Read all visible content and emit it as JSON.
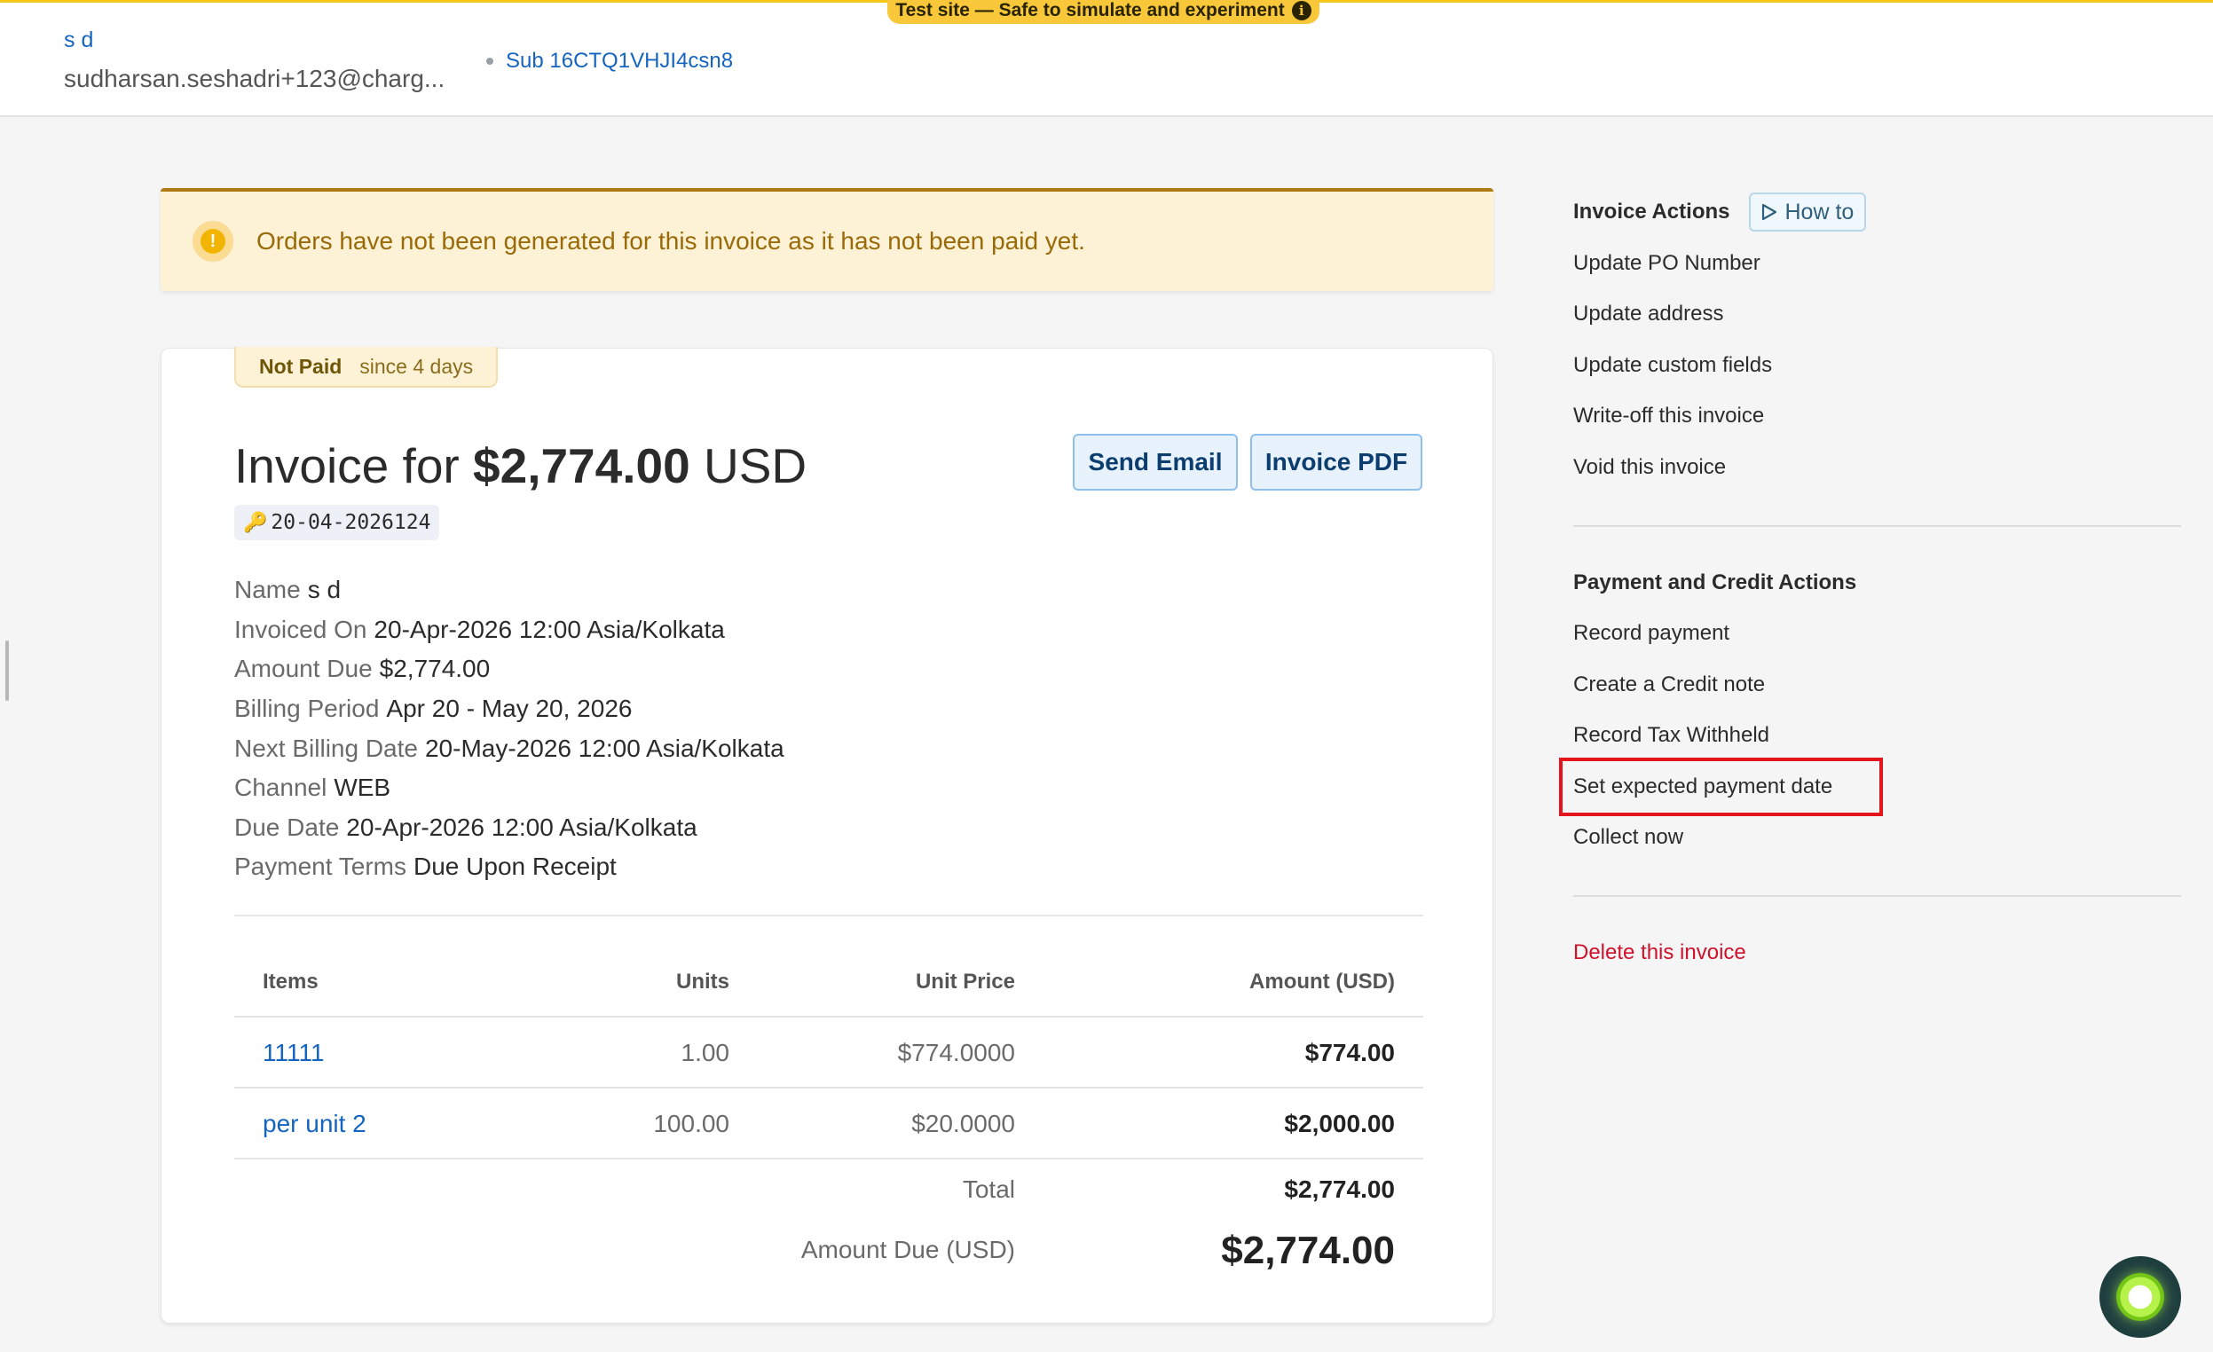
{
  "header": {
    "test_banner": "Test site — Safe to simulate and experiment",
    "info_glyph": "i",
    "customer_name": "s d",
    "customer_email": "sudharsan.seshadri+123@charg...",
    "subscription": "Sub 16CTQ1VHJI4csn8"
  },
  "banner": {
    "icon_glyph": "!",
    "message": "Orders have not been generated for this invoice as it has not been paid yet."
  },
  "invoice": {
    "status": "Not Paid",
    "status_since": "since 4 days",
    "title_prefix": "Invoice for",
    "amount": "$2,774.00",
    "currency": "USD",
    "send_email_label": "Send Email",
    "pdf_label": "Invoice PDF",
    "number": "20-04-2026124",
    "key_icon": "🔑",
    "details": [
      {
        "label": "Name",
        "value": "s d"
      },
      {
        "label": "Invoiced On",
        "value": "20-Apr-2026 12:00 Asia/Kolkata"
      },
      {
        "label": "Amount Due",
        "value": "$2,774.00"
      },
      {
        "label": "Billing Period",
        "value": "Apr 20 - May 20, 2026"
      },
      {
        "label": "Next Billing Date",
        "value": "20-May-2026 12:00 Asia/Kolkata"
      },
      {
        "label": "Channel",
        "value": "WEB"
      },
      {
        "label": "Due Date",
        "value": "20-Apr-2026 12:00 Asia/Kolkata"
      },
      {
        "label": "Payment Terms",
        "value": "Due Upon Receipt"
      }
    ],
    "columns": {
      "items": "Items",
      "units": "Units",
      "unit_price": "Unit Price",
      "amount": "Amount (USD)"
    },
    "line_items": [
      {
        "name": "11111",
        "units": "1.00",
        "unit_price": "$774.0000",
        "amount": "$774.00"
      },
      {
        "name": "per unit 2",
        "units": "100.00",
        "unit_price": "$20.0000",
        "amount": "$2,000.00"
      }
    ],
    "total_label": "Total",
    "total_value": "$2,774.00",
    "amount_due_label": "Amount Due (USD)",
    "amount_due_value": "$2,774.00"
  },
  "actions": {
    "invoice_title": "Invoice Actions",
    "how_to_label": "How to",
    "invoice_items": [
      "Update PO Number",
      "Update address",
      "Update custom fields",
      "Write-off this invoice",
      "Void this invoice"
    ],
    "payment_title": "Payment and Credit Actions",
    "payment_items": [
      "Record payment",
      "Create a Credit note",
      "Record Tax Withheld",
      "Set expected payment date",
      "Collect now"
    ],
    "delete_label": "Delete this invoice"
  },
  "colors": {
    "link": "#1565c0",
    "warning_bg": "#fdf2d6",
    "danger": "#d0112b",
    "highlight_box": "#e4141c"
  }
}
